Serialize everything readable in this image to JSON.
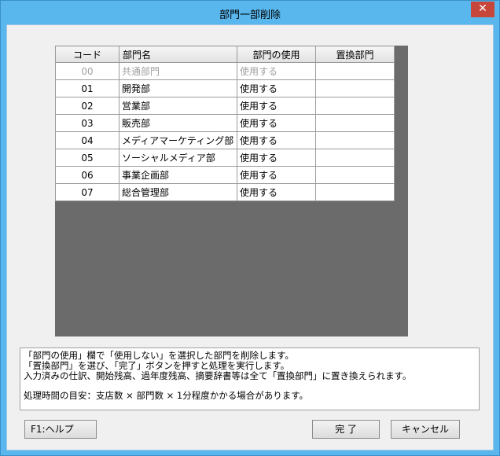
{
  "window": {
    "title": "部門一部削除",
    "close_glyph": "✕"
  },
  "grid": {
    "headers": {
      "code": "コード",
      "name": "部門名",
      "usage": "部門の使用",
      "replacement": "置換部門"
    },
    "rows": [
      {
        "code": "00",
        "name": "共通部門",
        "usage": "使用する",
        "replacement": "",
        "disabled": true
      },
      {
        "code": "01",
        "name": "開発部",
        "usage": "使用する",
        "replacement": ""
      },
      {
        "code": "02",
        "name": "営業部",
        "usage": "使用する",
        "replacement": ""
      },
      {
        "code": "03",
        "name": "販売部",
        "usage": "使用する",
        "replacement": ""
      },
      {
        "code": "04",
        "name": "メディアマーケティング部",
        "usage": "使用する",
        "replacement": ""
      },
      {
        "code": "05",
        "name": "ソーシャルメディア部",
        "usage": "使用する",
        "replacement": ""
      },
      {
        "code": "06",
        "name": "事業企画部",
        "usage": "使用する",
        "replacement": ""
      },
      {
        "code": "07",
        "name": "総合管理部",
        "usage": "使用する",
        "replacement": ""
      }
    ]
  },
  "description": {
    "line1": "「部門の使用」欄で「使用しない」を選択した部門を削除します。",
    "line2": "「置換部門」を選び、「完了」ボタンを押すと処理を実行します。",
    "line3": "入力済みの仕訳、開始残高、過年度残高、摘要辞書等は全て「置換部門」に置き換えられます。",
    "line4": "処理時間の目安：支店数 × 部門数 × 1分程度かかる場合があります。"
  },
  "buttons": {
    "help": "F1:ヘルプ",
    "done": "完 了",
    "cancel": "キャンセル"
  },
  "colors": {
    "titlebar": "#59b7ee",
    "close": "#c7463b",
    "grid_background": "#6b6b6b"
  }
}
